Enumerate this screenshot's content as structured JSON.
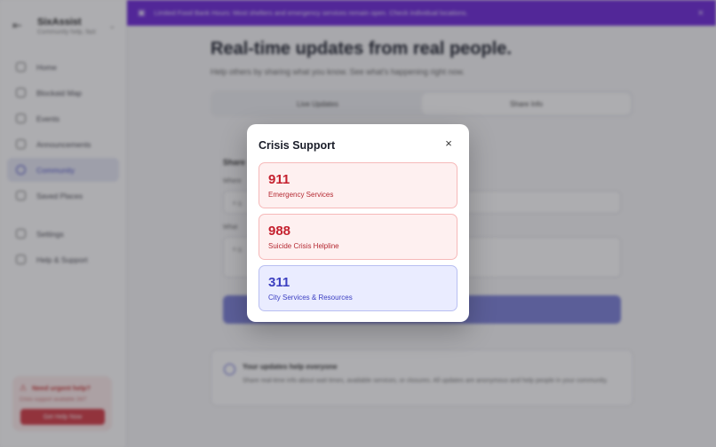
{
  "banner": {
    "text": "Limited Food Bank Hours: Most shelters and emergency services remain open. Check individual locations."
  },
  "brand": {
    "title": "SixAssist",
    "subtitle": "Community help, fast"
  },
  "nav": [
    {
      "label": "Home"
    },
    {
      "label": "Blockaid Map"
    },
    {
      "label": "Events"
    },
    {
      "label": "Announcements"
    },
    {
      "label": "Community"
    },
    {
      "label": "Saved Places"
    }
  ],
  "nav_bottom": [
    {
      "label": "Settings"
    },
    {
      "label": "Help & Support"
    }
  ],
  "urgent": {
    "title": "Need urgent help?",
    "desc": "Crisis support available 24/7",
    "button": "Get Help Now"
  },
  "main": {
    "headline": "Real-time updates from real people.",
    "lead": "Help others by sharing what you know. See what's happening right now.",
    "tabs": [
      "Live Updates",
      "Share Info"
    ]
  },
  "form": {
    "title": "Share",
    "label1": "Where",
    "placeholder1": "e.g.",
    "label2": "What",
    "placeholder2": "e.g."
  },
  "info": {
    "title": "Your updates help everyone",
    "desc": "Share real-time info about wait times, available services, or closures. All updates are anonymous and help people in your community."
  },
  "modal": {
    "title": "Crisis Support",
    "close_icon": "×",
    "cards": [
      {
        "number": "911",
        "label": "Emergency Services",
        "tone": "red"
      },
      {
        "number": "988",
        "label": "Suicide Crisis Helpline",
        "tone": "red"
      },
      {
        "number": "311",
        "label": "City Services & Resources",
        "tone": "blue"
      }
    ]
  },
  "colors": {
    "accent": "#4b4fc4",
    "banner": "#6d28d9",
    "danger": "#c5212f"
  }
}
